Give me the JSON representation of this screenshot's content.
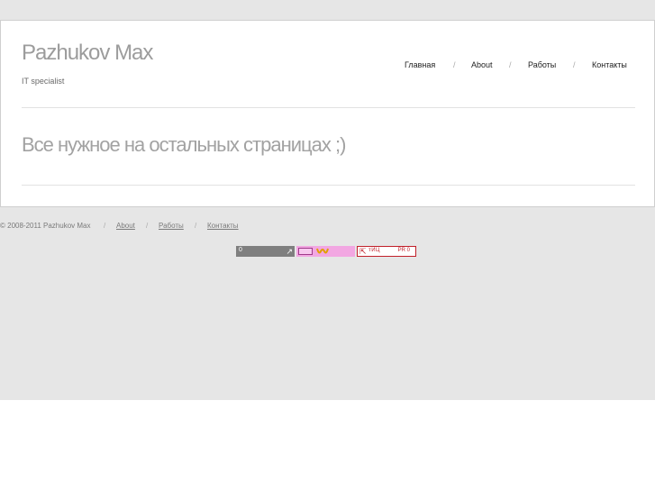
{
  "header": {
    "site_title": "Pazhukov Max",
    "tagline": "IT specialist"
  },
  "nav": {
    "items": [
      {
        "label": "Главная"
      },
      {
        "label": "About"
      },
      {
        "label": "Работы"
      },
      {
        "label": "Контакты"
      }
    ],
    "separator": "/"
  },
  "main": {
    "headline": "Все нужное на остальных страницах ;)"
  },
  "footer": {
    "copyright": "© 2008-2011 Pazhukov Max",
    "separator": "/",
    "links": [
      {
        "label": "About"
      },
      {
        "label": "Работы"
      },
      {
        "label": "Контакты"
      }
    ]
  },
  "counters": {
    "liveinternet": {
      "value": "0",
      "icon": "arrow-icon"
    },
    "mail_ru": {
      "icon": "mail-ru-logo"
    },
    "yandex_cy": {
      "label": "тИЦ",
      "value": "PR 0",
      "icon": "arrow-up-left-icon"
    }
  },
  "colors": {
    "page_background": "#e6e6e6",
    "card_background": "#ffffff",
    "title_gray": "#9c9c9c",
    "counter_red": "#c0202a",
    "counter_pink": "#f2a7e2"
  }
}
